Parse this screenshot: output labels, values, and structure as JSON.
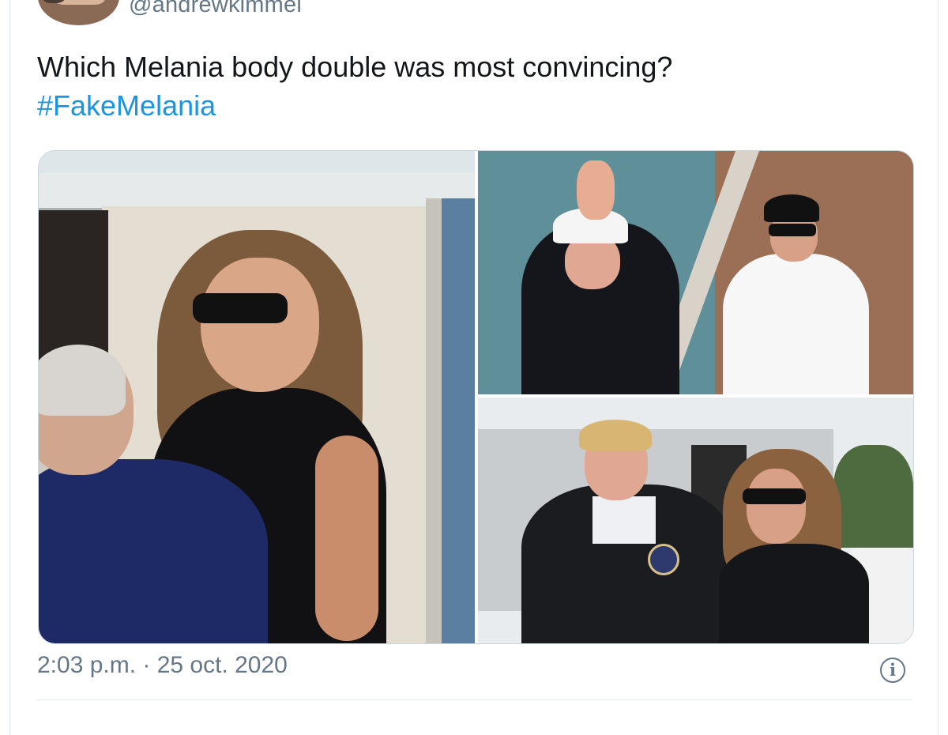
{
  "tweet": {
    "handle": "@andrewkimmel",
    "text": "Which Melania body double was most convincing?",
    "hashtag": "#FakeMelania",
    "timestamp": "2:03 p.m. · 25 oct. 2020"
  },
  "media": {
    "photos": [
      {
        "name": "photo-1"
      },
      {
        "name": "photo-2"
      },
      {
        "name": "photo-3"
      }
    ]
  },
  "icons": {
    "info": "info-icon",
    "info_glyph": "i"
  },
  "colors": {
    "text": "#14171a",
    "muted": "#657786",
    "link": "#1b95e0",
    "border": "#e1e8ed"
  }
}
